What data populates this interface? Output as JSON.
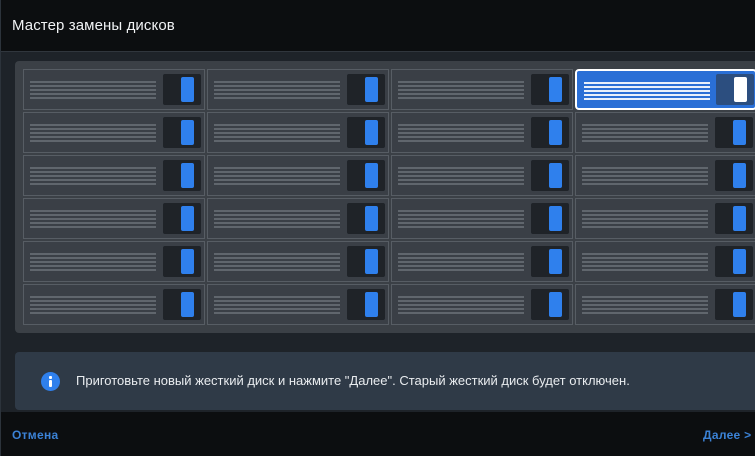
{
  "dialog": {
    "title": "Мастер замены дисков"
  },
  "disk_bay": {
    "columns": 4,
    "rows": 6,
    "selected_slot": {
      "row": 1,
      "column": 4
    },
    "led_color": "#2f80ed",
    "selected_color": "#2a6fd6"
  },
  "info": {
    "icon": "info-icon",
    "message": "Приготовьте новый жесткий диск и нажмите \"Далее\". Старый жесткий диск будет отключен."
  },
  "footer": {
    "cancel_label": "Отмена",
    "next_label": "Далее >"
  }
}
